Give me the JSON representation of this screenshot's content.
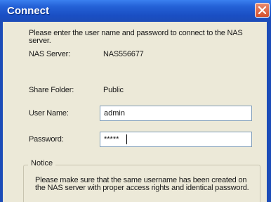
{
  "window": {
    "title": "Connect"
  },
  "intro": "Please enter the user name and password to connect to the NAS server.",
  "nas_server": {
    "label": "NAS Server:",
    "value": "NAS556677"
  },
  "share_folder": {
    "label": "Share Folder:",
    "value": "Public"
  },
  "user_name": {
    "label": "User Name:",
    "value": "admin"
  },
  "password": {
    "label": "Password:",
    "value": "*****"
  },
  "notice": {
    "title": "Notice",
    "text": "Please make sure that the same username has been created on the NAS server with proper access rights and identical password."
  },
  "colors": {
    "titlebar": "#2461d6",
    "close_button": "#d4502c",
    "window_bg": "#ece9d8"
  },
  "icons": {
    "close": "close-icon"
  }
}
